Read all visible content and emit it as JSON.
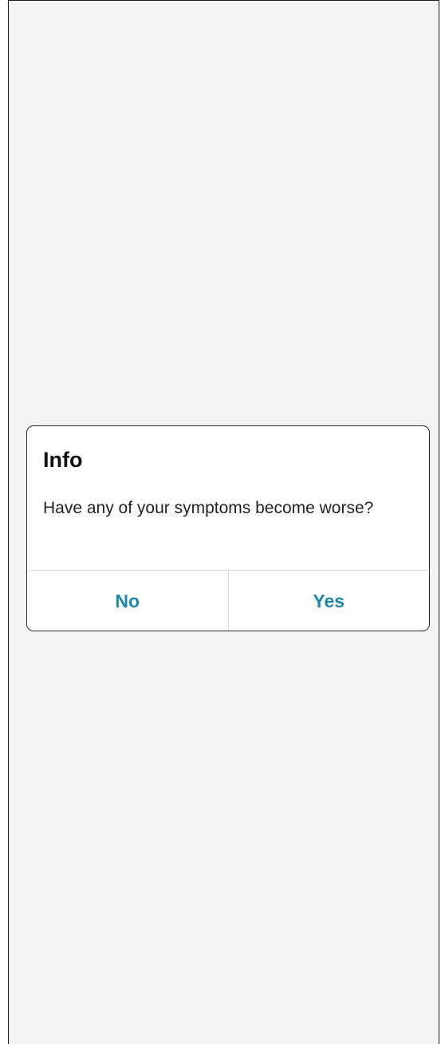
{
  "dialog": {
    "title": "Info",
    "message": "Have any of your symptoms become worse?",
    "buttons": {
      "no": "No",
      "yes": "Yes"
    }
  },
  "colors": {
    "background": "#f4f4f4",
    "dialog_background": "#ffffff",
    "button_text": "#1d87b0",
    "title_text": "#111111"
  }
}
